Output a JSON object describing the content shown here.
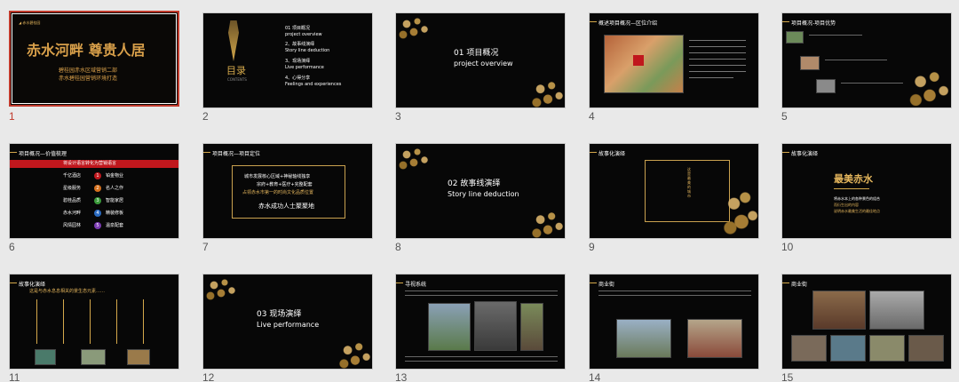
{
  "slides": [
    {
      "num": "1",
      "title": "赤水河畔  尊贵人居",
      "line1": "碧桂园赤水区域营销二部",
      "line2": "赤水碧桂园营销环境打造"
    },
    {
      "num": "2",
      "brand": "目录",
      "brand_sub": "CONTENTS",
      "items": [
        {
          "cn": "01 项目概况",
          "en": "project overview"
        },
        {
          "cn": "2、故事线演绎",
          "en": "Story line deduction"
        },
        {
          "cn": "3、现场演绎",
          "en": "Live performance"
        },
        {
          "cn": "4、心得分享",
          "en": "Feelings and experiences"
        }
      ]
    },
    {
      "num": "3",
      "cn": "01 项目概况",
      "en": "project overview"
    },
    {
      "num": "4",
      "header": "概述项目概况—区位介绍"
    },
    {
      "num": "5",
      "header": "项目概况-项目优势"
    },
    {
      "num": "6",
      "header": "项目概况—价值梳理",
      "banner": "将设计语言转化为营销语言",
      "rows": [
        {
          "label": "千亿酒店",
          "n": "1",
          "right": "铂金物业"
        },
        {
          "label": "星级服务",
          "n": "2",
          "right": "名人之作"
        },
        {
          "label": "碧桂品质",
          "n": "3",
          "right": "智能家居"
        },
        {
          "label": "赤水河畔",
          "n": "4",
          "right": "精装修板"
        },
        {
          "label": "风情园林",
          "n": "5",
          "right": "温泉配套"
        }
      ]
    },
    {
      "num": "7",
      "header": "项目概况—项目定位",
      "line1": "城市发展核心区域+神秘轴线独享",
      "line2": "宗府+教育+医疗+完整配套",
      "line3": "占领赤水市第一的时尚文化品质位置",
      "line4": "赤水成功人士聚聚地"
    },
    {
      "num": "8",
      "cn": "02 故事线演绎",
      "en": "Story line deduction"
    },
    {
      "num": "9",
      "header": "故事化演绎",
      "vertical": "这是最美的城市"
    },
    {
      "num": "10",
      "header": "故事化演绎",
      "title": "最美赤水",
      "sub1": "将赤水本上的各种景色的组合",
      "sub2": "而衍生出的内容",
      "sub3": "说明赤水最美生活的最佳地点"
    },
    {
      "num": "11",
      "header": "故事化演绎",
      "sub": "这是与赤水息息相关的景生态元素……"
    },
    {
      "num": "12",
      "cn": "03 现场演绎",
      "en": "Live performance"
    },
    {
      "num": "13",
      "header": "寻视系统"
    },
    {
      "num": "14",
      "header": "商业街"
    },
    {
      "num": "15",
      "header": "商业街"
    }
  ],
  "colors": {
    "accent_gold": "#d4a84b",
    "selection_red": "#c0392b",
    "slide_bg": "#070707",
    "banner_red": "#c0171d"
  }
}
